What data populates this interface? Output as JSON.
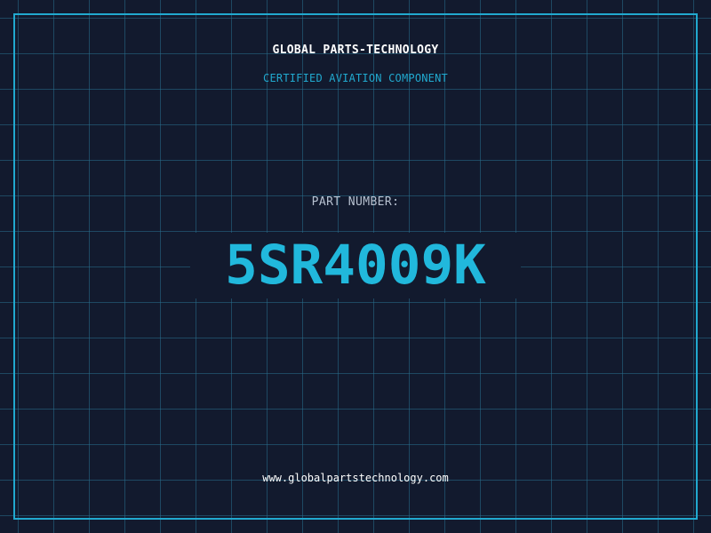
{
  "header": {
    "company": "GLOBAL PARTS-TECHNOLOGY",
    "subtitle": "CERTIFIED AVIATION COMPONENT"
  },
  "part": {
    "label": "PART NUMBER:",
    "number": "5SR4009K"
  },
  "footer": {
    "website": "www.globalpartstechnology.com"
  },
  "colors": {
    "background": "#121a2e",
    "accent": "#21a9cf",
    "part_number": "#21b8dc",
    "grid": "#286e8c",
    "label": "#b8c2d1",
    "text": "#ffffff"
  }
}
